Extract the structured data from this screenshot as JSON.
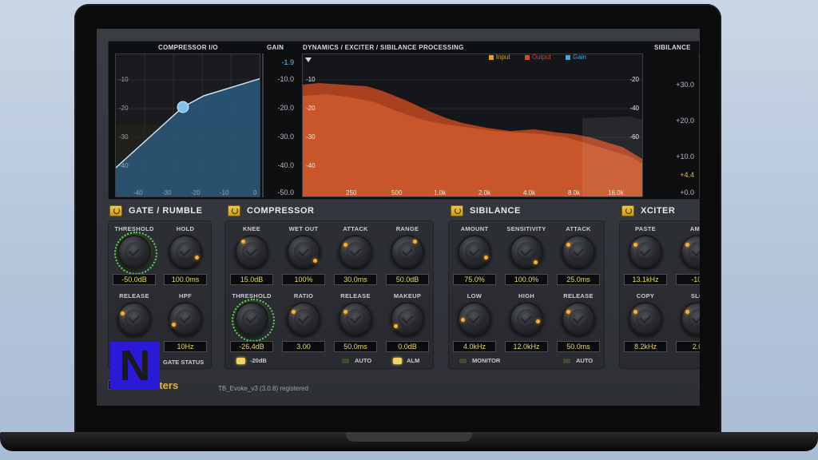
{
  "plugin": {
    "display": {
      "compressor_io_title": "COMPRESSOR I/O",
      "gain_title": "GAIN",
      "dynamics_title": "DYNAMICS / EXCITER / SIBILANCE PROCESSING",
      "sibilance_title": "SIBILANCE",
      "legend": {
        "input": "Input",
        "output": "Output",
        "gain": "Gain"
      },
      "legend_colors": {
        "input": "#e0a21a",
        "output": "#cc4a2a",
        "gain": "#4aa3d8"
      },
      "io_y_labels": [
        "-10",
        "-20",
        "-30",
        "-40"
      ],
      "io_x_labels": [
        "-40",
        "-30",
        "-20",
        "-10",
        "0"
      ],
      "gain_labels": [
        "-1.9",
        "-10.0",
        "-20.0",
        "-30.0",
        "-40.0",
        "-50.0"
      ],
      "spectrum_left_labels": [
        "-10",
        "-20",
        "-30",
        "-40"
      ],
      "spectrum_right_labels": [
        "-20",
        "-40",
        "-60"
      ],
      "spectrum_x_labels": [
        "250",
        "500",
        "1.0k",
        "2.0k",
        "4.0k",
        "8.0k",
        "16.0k"
      ],
      "sib_labels": [
        "+30.0",
        "+20.0",
        "+10.0",
        "+4.4",
        "+0.0"
      ]
    },
    "sections": {
      "gate": {
        "title": "GATE / RUMBLE"
      },
      "compressor": {
        "title": "COMPRESSOR"
      },
      "sibilance": {
        "title": "SIBILANCE"
      },
      "xciter": {
        "title": "XCITER"
      }
    },
    "gate": {
      "threshold": {
        "label": "THRESHOLD",
        "value": "-50.0dB"
      },
      "hold": {
        "label": "HOLD",
        "value": "100.0ms"
      },
      "release": {
        "label": "RELEASE",
        "value": ""
      },
      "hpf": {
        "label": "HPF",
        "value": "10Hz"
      },
      "status": "GATE STATUS"
    },
    "compressor": {
      "knee": {
        "label": "KNEE",
        "value": "15.0dB"
      },
      "wet_out": {
        "label": "WET OUT",
        "value": "100%"
      },
      "attack": {
        "label": "ATTACK",
        "value": "30.0ms"
      },
      "range": {
        "label": "RANGE",
        "value": "50.0dB"
      },
      "threshold": {
        "label": "THRESHOLD",
        "value": "-26.4dB"
      },
      "ratio": {
        "label": "RATIO",
        "value": "3.00"
      },
      "release": {
        "label": "RELEASE",
        "value": "50.0ms"
      },
      "makeup": {
        "label": "MAKEUP",
        "value": "0.0dB"
      },
      "toggle_20db": "-20dB",
      "toggle_auto": "AUTO",
      "toggle_alm": "ALM"
    },
    "sibilance": {
      "amount": {
        "label": "AMOUNT",
        "value": "75.0%"
      },
      "sensitivity": {
        "label": "SENSITIVITY",
        "value": "100.0%"
      },
      "attack": {
        "label": "ATTACK",
        "value": "25.0ms"
      },
      "low": {
        "label": "LOW",
        "value": "4.0kHz"
      },
      "high": {
        "label": "HIGH",
        "value": "12.0kHz"
      },
      "release": {
        "label": "RELEASE",
        "value": "50.0ms"
      },
      "toggle_monitor": "MONITOR",
      "toggle_auto": "AUTO"
    },
    "xciter": {
      "paste": {
        "label": "PASTE",
        "value": "13.1kHz"
      },
      "amount": {
        "label": "AMO",
        "value": "-10."
      },
      "copy": {
        "label": "COPY",
        "value": "8.2kHz"
      },
      "slope": {
        "label": "SLO",
        "value": "2.0"
      }
    },
    "footer": {
      "brand": "oosters",
      "brand_partial": "C",
      "version": "TB_Evoke_v3 (3.0.8) registered"
    },
    "overlay_logo": "N"
  }
}
